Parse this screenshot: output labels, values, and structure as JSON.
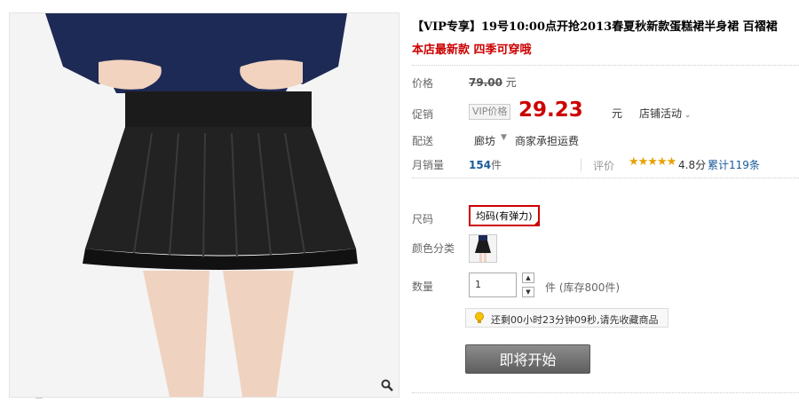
{
  "product": {
    "title": "【VIP专享】19号10:00点开抢2013春夏秋新款蛋糕裙半身裙 百褶裙",
    "subtitle": "本店最新款 四季可穿哦"
  },
  "price": {
    "label": "价格",
    "original": "79.00",
    "unit": "元",
    "promo_label": "促销",
    "vip_tag": "VIP价格",
    "promo_value": "29.23",
    "promo_unit": "元",
    "activity": "店铺活动"
  },
  "shipping": {
    "label": "配送",
    "location": "廊坊",
    "freight": "商家承担运费"
  },
  "sales": {
    "label": "月销量",
    "count": "154",
    "count_unit": "件",
    "rating_label": "评价",
    "stars": "★★★★★",
    "score": "4.8分",
    "reviews": "累计119条"
  },
  "options": {
    "size_label": "尺码",
    "size_value": "均码(有弹力)",
    "color_label": "颜色分类",
    "qty_label": "数量",
    "qty_value": "1",
    "stock": "件 (库存800件)",
    "step_up": "▲",
    "step_down": "▼"
  },
  "notice": {
    "text": "还剩00小时23分钟09秒,请先收藏商品"
  },
  "buy": {
    "label": "即将开始"
  },
  "colors": {
    "red": "#cc0000",
    "link": "#1a5a9a",
    "star": "#e6a100"
  }
}
